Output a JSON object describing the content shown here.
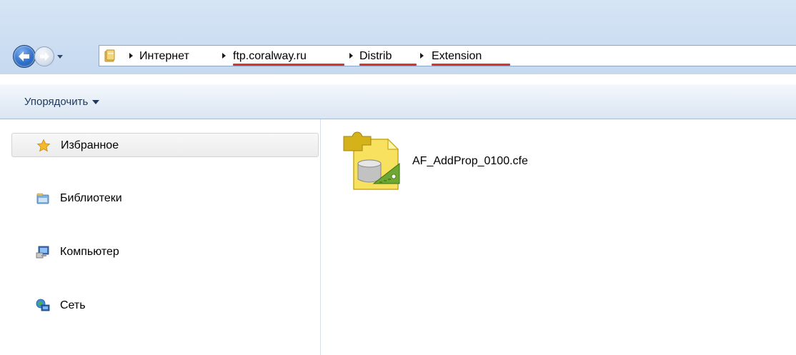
{
  "address_bar": {
    "breadcrumbs": [
      {
        "label": "Интернет"
      },
      {
        "label": "ftp.coralway.ru"
      },
      {
        "label": "Distrib"
      },
      {
        "label": "Extension"
      }
    ]
  },
  "toolbar": {
    "organize_label": "Упорядочить"
  },
  "nav_pane": {
    "items": [
      {
        "label": "Избранное",
        "icon": "star-icon",
        "selected": true
      },
      {
        "label": "Библиотеки",
        "icon": "libraries-icon",
        "selected": false
      },
      {
        "label": "Компьютер",
        "icon": "computer-icon",
        "selected": false
      },
      {
        "label": "Сеть",
        "icon": "network-icon",
        "selected": false
      }
    ]
  },
  "files": [
    {
      "name": "AF_AddProp_0100.cfe",
      "icon": "extension-file-icon"
    }
  ],
  "colors": {
    "highlight_underline": "#d9342b",
    "titlebar": "#cfe0f3",
    "toolbar_text": "#1e395b"
  }
}
